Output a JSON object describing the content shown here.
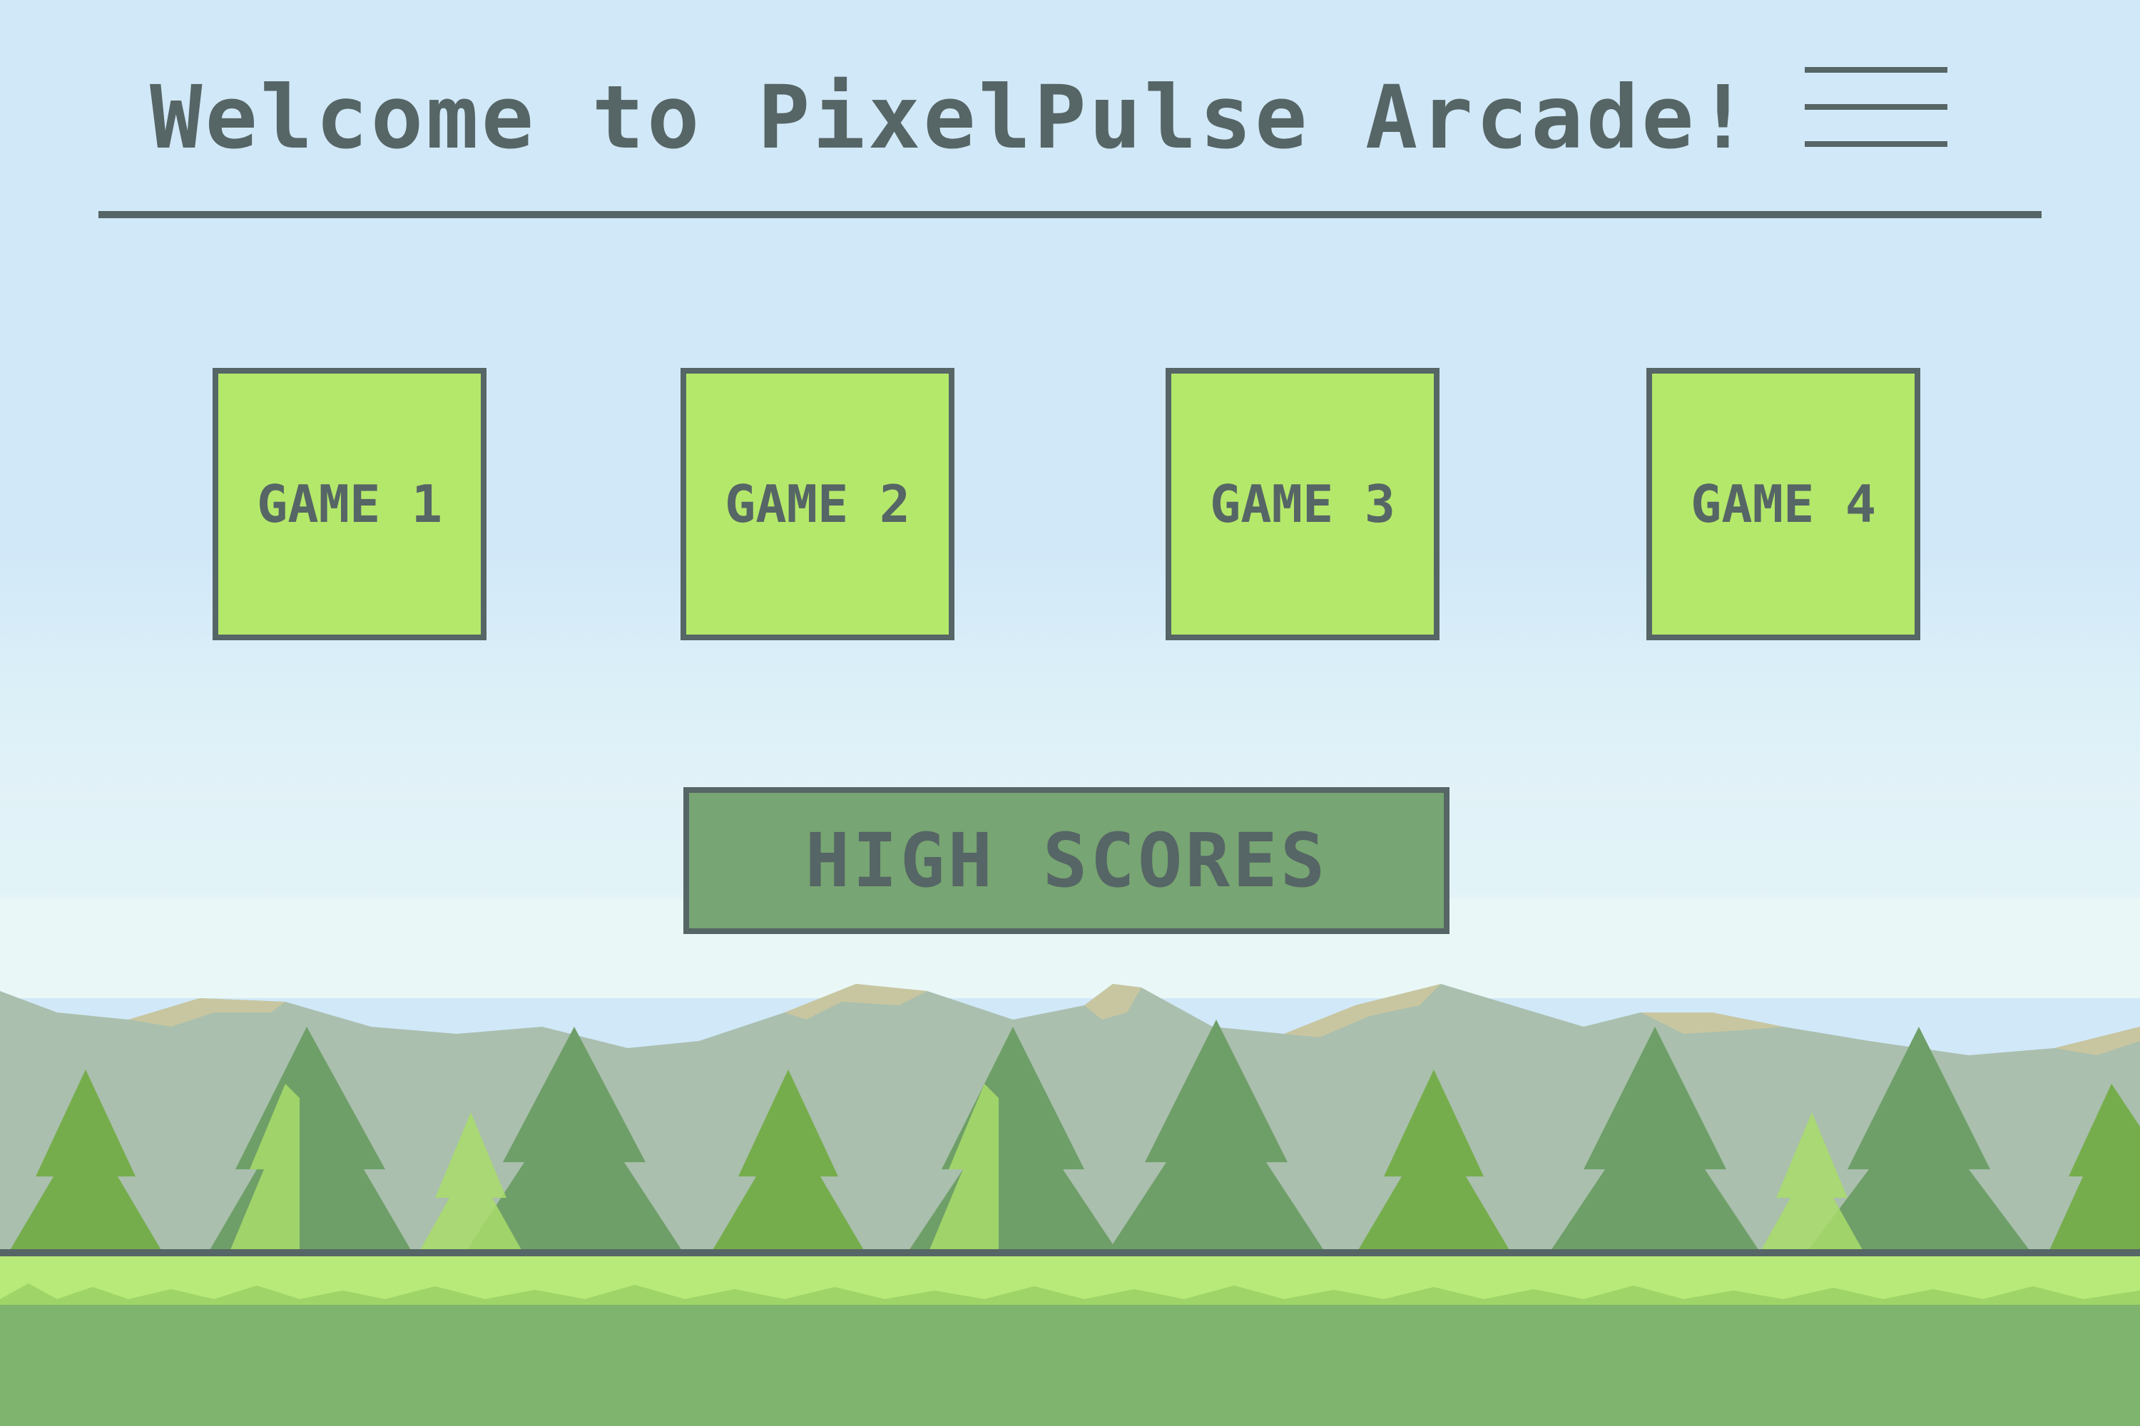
{
  "header": {
    "title": "Welcome to PixelPulse Arcade!",
    "menu_icon": "hamburger-menu-icon"
  },
  "games": [
    {
      "label": "GAME 1"
    },
    {
      "label": "GAME 2"
    },
    {
      "label": "GAME 3"
    },
    {
      "label": "GAME 4"
    }
  ],
  "high_scores": {
    "label": "HIGH SCORES"
  },
  "colors": {
    "sky": "#d1e8f8",
    "ink": "#566565",
    "tile_green": "#b4e86b",
    "button_green": "#77a573",
    "mountain": "#aabfae",
    "mountain_snow": "#c8c6a0",
    "tree_dark": "#6f9f68",
    "tree_mid": "#76ad4c",
    "tree_light": "#a9dc6a",
    "grass_light": "#b7ea78",
    "ground": "#7fb46e"
  }
}
